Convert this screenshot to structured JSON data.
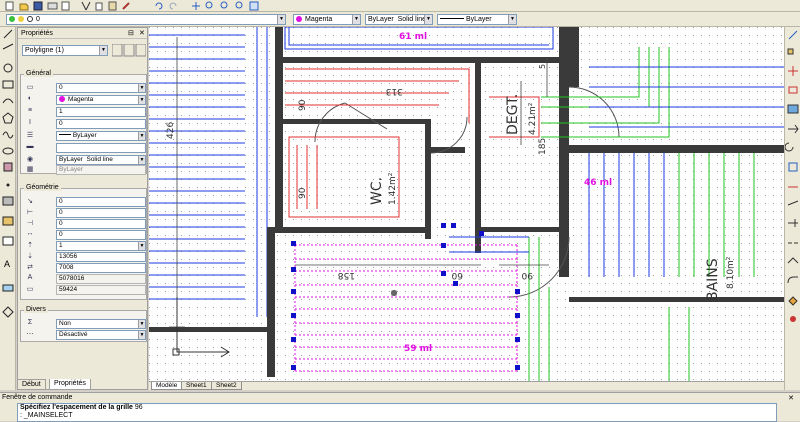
{
  "toolbar": {
    "layer_value": "0",
    "color_value": "Magenta",
    "linetype_value": "ByLayer",
    "linetype_style": "Solid line",
    "lineweight_value": "ByLayer",
    "icons": [
      "new-icon",
      "open-icon",
      "save-icon",
      "print-icon",
      "preview-icon",
      "cut-icon",
      "copy-icon",
      "paste-icon",
      "match-icon",
      "undo-icon",
      "redo-icon",
      "pan-icon",
      "zoom-realtime-icon",
      "zoom-window-icon",
      "zoom-previous-icon",
      "properties-icon"
    ]
  },
  "properties_panel": {
    "title": "Propriétés",
    "selection": "Polyligne (1)",
    "general": {
      "title": "Général",
      "color": "",
      "layer": "0",
      "color_name": "Magenta",
      "field3": "1",
      "field4": "0",
      "linetype": "ByLayer",
      "field6": "",
      "plot_style": "ByLayer",
      "plot_linetype": "Solid line",
      "plot_by": "ByLayer"
    },
    "geometry": {
      "title": "Géométrie",
      "values": [
        "0",
        "0",
        "0",
        "0",
        "1",
        "13056",
        "7008",
        "5078016",
        "59424"
      ]
    },
    "divers": {
      "title": "Divers",
      "v1": "Non",
      "v2": "Désactivé"
    },
    "tabs": [
      "Début",
      "Propriétés"
    ]
  },
  "drawing": {
    "labels": {
      "top_length": "61 ml",
      "degt": "DEGT.",
      "degt_area": "4.21m²",
      "wc": "WC.",
      "wc_area": "1.42m²",
      "bains": "BAINS",
      "bains_area": "8.10m²",
      "len_46": "46 ml",
      "len_59": "59 ml",
      "dim_426": "426",
      "dim_313": "313",
      "dim_90a": "90",
      "dim_90b": "90",
      "dim_185": "185",
      "dim_158": "158",
      "dim_60": "60",
      "dim_90c": "90",
      "dim_5": "5"
    },
    "colors": {
      "magenta": "#e010e0",
      "red": "#e03030",
      "blue": "#1c3adf",
      "green": "#22c422",
      "wall": "#3a3a3a"
    }
  },
  "layout_tabs": [
    "Modèle",
    "Sheet1",
    "Sheet2"
  ],
  "command": {
    "title": "Fenêtre de commande",
    "line1": "Spécifiez l'espacement de la grille",
    "line1_value": "96",
    "line2": ": _MAINSELECT"
  }
}
